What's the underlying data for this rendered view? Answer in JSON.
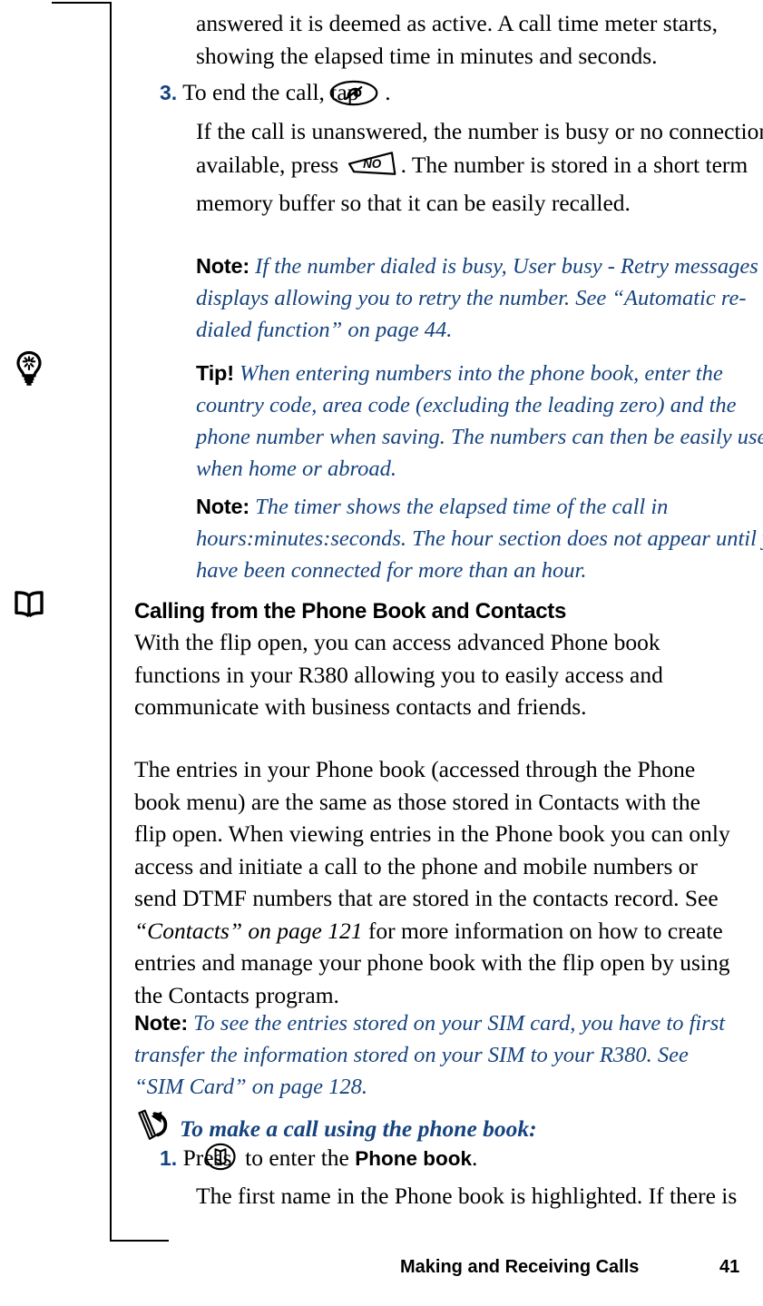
{
  "document": {
    "type": "user-manual-page",
    "accent_color": "#15437e",
    "text_color": "#000000",
    "background_color": "#ffffff"
  },
  "margin_icons": [
    {
      "name": "lightbulb-icon",
      "meaning": "tip"
    },
    {
      "name": "open-book-icon",
      "meaning": "reference"
    }
  ],
  "content": {
    "continued_paragraph": "answered it is deemed as active. A call time meter starts, showing the elapsed time in minutes and seconds.",
    "step_3": {
      "number": "3.",
      "lead_before_icon": "To end the call, tap",
      "icon": "end-call-key-icon",
      "lead_after_icon": "."
    },
    "step_3_body_part1": "If the call is unanswered, the number is busy or no connection is available, press",
    "step_3_key_label": "NO",
    "step_3_body_part2": ". The number is stored in a short term memory buffer so that it can be easily recalled.",
    "note_1": {
      "label": "Note:",
      "text": "If the number dialed is busy, User busy - Retry messages displays allowing you to retry the number. See “Automatic re-dialed function” on page 44."
    },
    "tip_1": {
      "label": "Tip!",
      "text": "When entering numbers into the phone book, enter the country code, area code (excluding the leading zero) and the phone number when saving. The numbers can then be easily used when home or abroad."
    },
    "note_2": {
      "label": "Note:",
      "text": "The timer shows the elapsed time of the call in hours:minutes:seconds. The hour section does not appear until you have been connected for more than an hour."
    },
    "section_heading": "Calling from the Phone Book and Contacts",
    "paragraph_1": "With the flip open, you can access advanced Phone book functions in your R380 allowing you to easily access and communicate with business contacts and friends.",
    "paragraph_2_part1": "The entries in your Phone book (accessed through the Phone book menu) are the same as those stored in Contacts with the flip open. When viewing entries in the Phone book you can only access and initiate a call to the phone and mobile numbers or send DTMF numbers that are stored in the contacts record. See ",
    "paragraph_2_xref": "“Contacts” on page 121",
    "paragraph_2_part2": " for more information on how to create entries and manage your phone book with the flip open by using the Contacts program.",
    "note_3": {
      "label": "Note:",
      "text": "To see the entries stored on your SIM card, you have to first transfer the information stored on your SIM to your R380. See “SIM Card” on page 128."
    },
    "procedure_heading": "To make a call using the phone book:",
    "procedure_icon": "stylus-arrow-icon",
    "step_1": {
      "number": "1.",
      "lead_before_icon": "Press",
      "icon": "phone-book-key-icon",
      "lead_after_icon": "to enter the",
      "bold_term": "Phone book",
      "trailing": "."
    },
    "step_1_body": "The first name in the Phone book is highlighted. If there is"
  },
  "footer": {
    "chapter_title": "Making and Receiving Calls",
    "page_number": "41"
  }
}
